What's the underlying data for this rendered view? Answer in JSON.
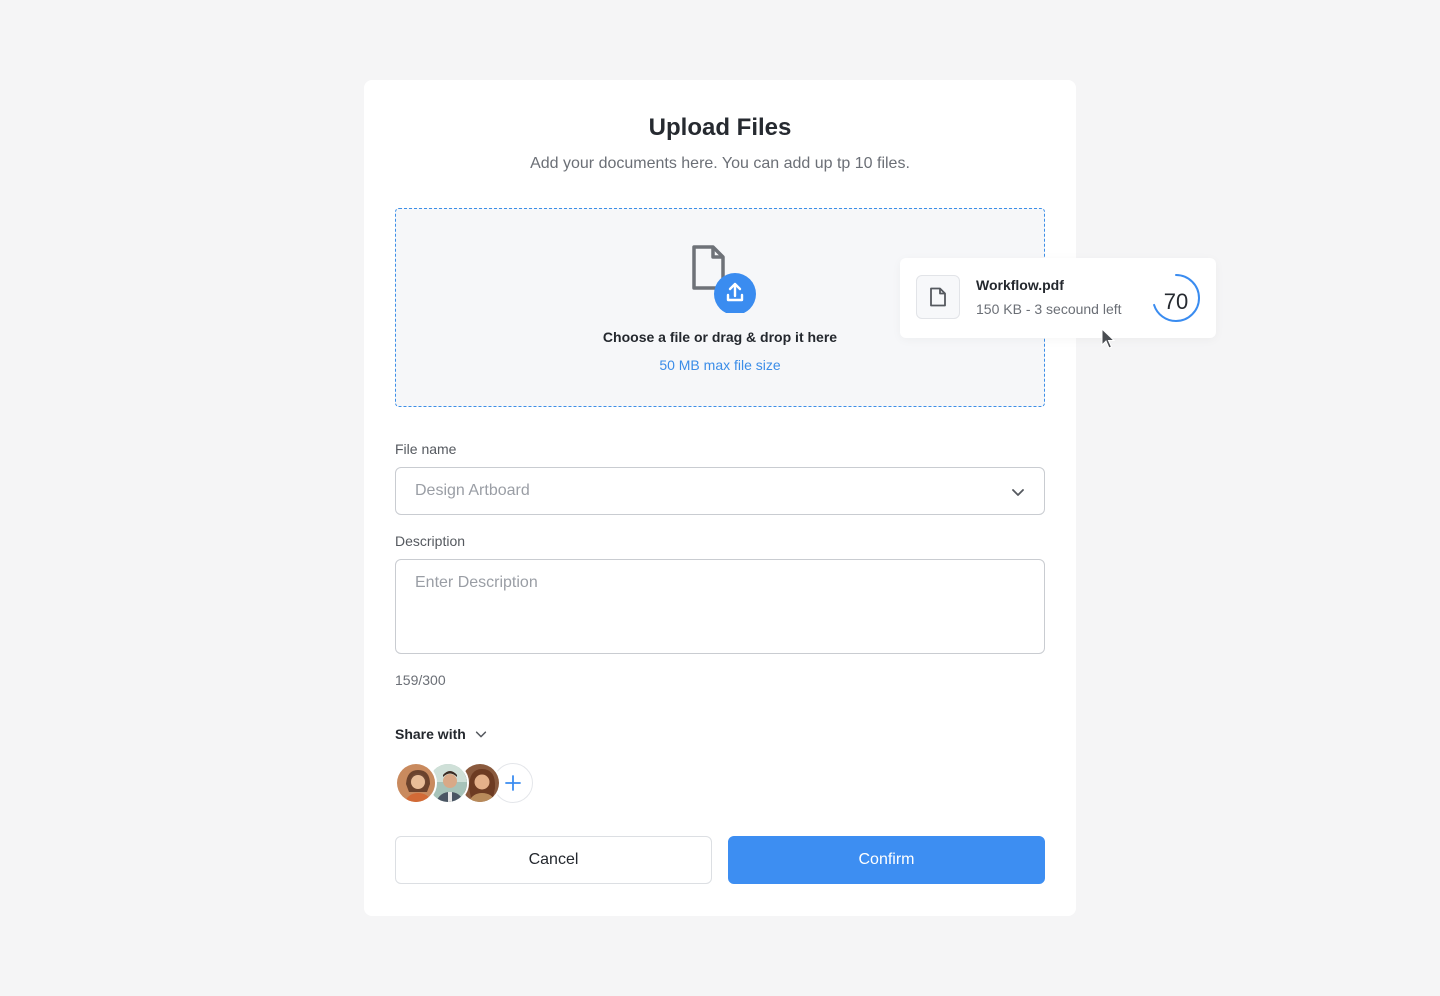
{
  "modal": {
    "title": "Upload Files",
    "subtitle": "Add your documents here. You can add up tp 10 files."
  },
  "dropzone": {
    "icon": "file-upload-icon",
    "text": "Choose a file or drag & drop it here",
    "hint": "50 MB max file size"
  },
  "form": {
    "file_name_label": "File name",
    "file_name_value": "Design Artboard",
    "description_label": "Description",
    "description_placeholder": "Enter Description",
    "char_count": "159/300",
    "share_label": "Share with"
  },
  "share": {
    "avatars": [
      "avatar-1",
      "avatar-2",
      "avatar-3"
    ],
    "add_icon": "plus-icon"
  },
  "actions": {
    "cancel_label": "Cancel",
    "confirm_label": "Confirm"
  },
  "upload_toast": {
    "file_name": "Workflow.pdf",
    "meta": "150 KB - 3 secound left",
    "progress_label": "70",
    "progress_fraction": 0.7
  },
  "colors": {
    "accent": "#3d8ef2",
    "dropzone_border": "#3d8fe8",
    "background": "#f5f5f6"
  }
}
